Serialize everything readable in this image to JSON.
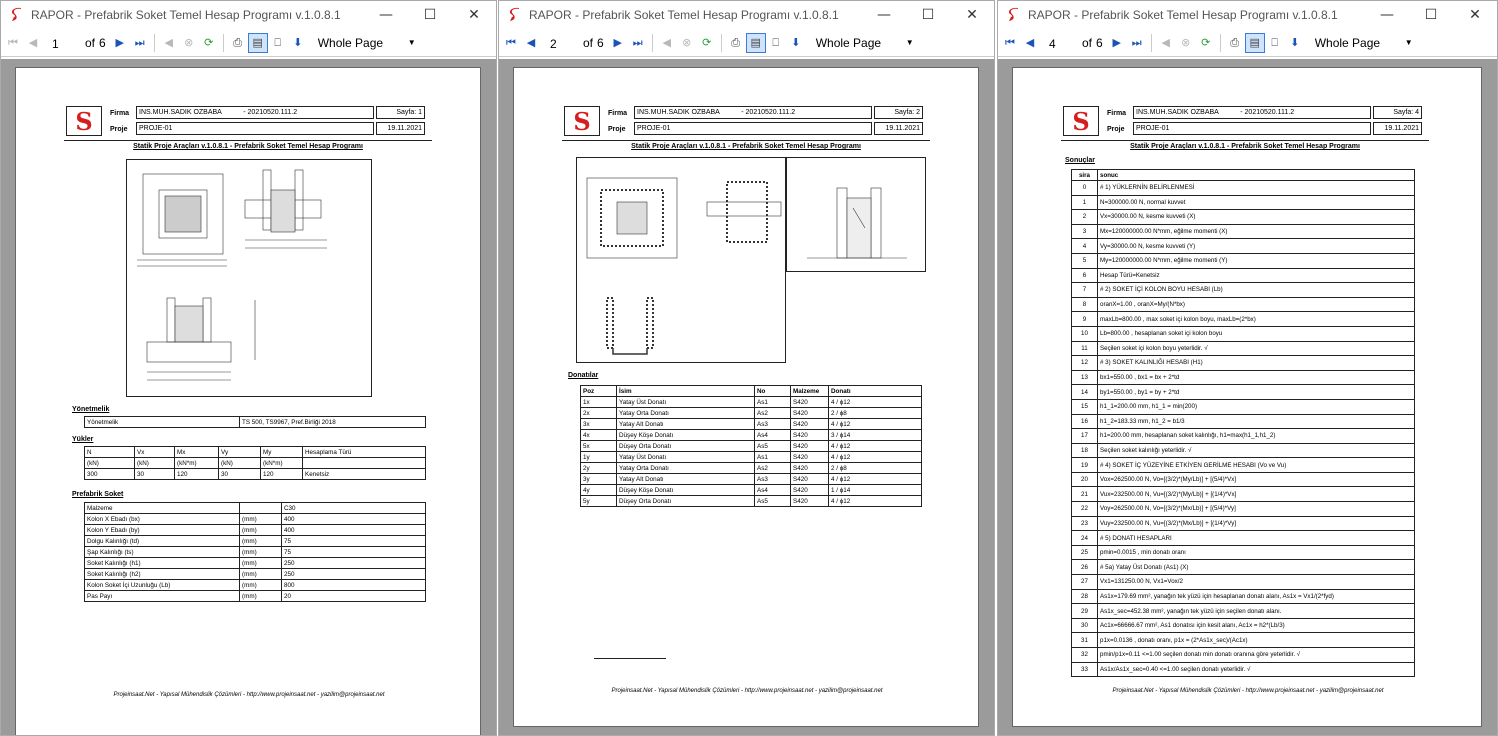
{
  "app": {
    "title": "RAPOR - Prefabrik Soket Temel Hesap Programı v.1.0.8.1",
    "minimize": "—",
    "maximize": "☐",
    "close": "✕"
  },
  "toolbar": {
    "of_label": "of",
    "total_pages": "6",
    "zoom": "Whole Page"
  },
  "windows": [
    {
      "page_input": "1"
    },
    {
      "page_input": "2"
    },
    {
      "page_input": "4"
    }
  ],
  "doc": {
    "firma_label": "Firma",
    "proje_label": "Proje",
    "firma_value": "INS.MUH.SADIK OZBABA",
    "code": "- 20210520.111.2",
    "proje_value": "PROJE-01",
    "date": "19.11.2021",
    "title": "Statik Proje Araçları v.1.0.8.1 - Prefabrik Soket Temel Hesap Programı",
    "footer": "Projeinsaat.Net - Yapısal Mühendislik Çözümleri - http://www.projeinsaat.net - yazilim@projeinsaat.net"
  },
  "page1": {
    "sayfa": "Sayfa: 1",
    "yonetmelik_title": "Yönetmelik",
    "yonetmelik_label": "Yönetmelik",
    "yonetmelik_value": "TS 500, TS9967, Pref.Birliği 2018",
    "yukler_title": "Yükler",
    "yukler_headers": [
      "N",
      "Vx",
      "Mx",
      "Vy",
      "My",
      "Hesaplama Türü"
    ],
    "yukler_units": [
      "(kN)",
      "(kN)",
      "(kN*m)",
      "(kN)",
      "(kN*m)",
      ""
    ],
    "yukler_values": [
      "300",
      "30",
      "120",
      "30",
      "120",
      "Kenetsiz"
    ],
    "soket_title": "Prefabrik Soket",
    "soket_rows": [
      [
        "Malzeme",
        "",
        "C30"
      ],
      [
        "Kolon X Ebadı (bx)",
        "(mm)",
        "400"
      ],
      [
        "Kolon Y Ebadı (by)",
        "(mm)",
        "400"
      ],
      [
        "Dolgu Kalınlığı (td)",
        "(mm)",
        "75"
      ],
      [
        "Şap Kalınlığı (ts)",
        "(mm)",
        "75"
      ],
      [
        "Soket Kalınlığı (h1)",
        "(mm)",
        "250"
      ],
      [
        "Soket Kalınlığı (h2)",
        "(mm)",
        "250"
      ],
      [
        "Kolon Soket İçi Uzunluğu (Lb)",
        "(mm)",
        "800"
      ],
      [
        "Pas Payı",
        "(mm)",
        "20"
      ]
    ]
  },
  "page2": {
    "sayfa": "Sayfa: 2",
    "donatilar_title": "Donatılar",
    "headers": [
      "Poz",
      "İsim",
      "No",
      "Malzeme",
      "Donatı"
    ],
    "rows": [
      [
        "1x",
        "Yatay Üst Donatı",
        "As1",
        "S420",
        "4 / ϕ12"
      ],
      [
        "2x",
        "Yatay Orta Donatı",
        "As2",
        "S420",
        "2 / ϕ8"
      ],
      [
        "3x",
        "Yatay Alt Donatı",
        "As3",
        "S420",
        "4 / ϕ12"
      ],
      [
        "4x",
        "Düşey Köşe Donatı",
        "As4",
        "S420",
        "3 / ϕ14"
      ],
      [
        "5x",
        "Düşey Orta Donatı",
        "As5",
        "S420",
        "4 / ϕ12"
      ],
      [
        "1y",
        "Yatay Üst Donatı",
        "As1",
        "S420",
        "4 / ϕ12"
      ],
      [
        "2y",
        "Yatay Orta Donatı",
        "As2",
        "S420",
        "2 / ϕ8"
      ],
      [
        "3y",
        "Yatay Alt Donatı",
        "As3",
        "S420",
        "4 / ϕ12"
      ],
      [
        "4y",
        "Düşey Köşe Donatı",
        "As4",
        "S420",
        "1 / ϕ14"
      ],
      [
        "5y",
        "Düşey Orta Donatı",
        "As5",
        "S420",
        "4 / ϕ12"
      ]
    ]
  },
  "page4": {
    "sayfa": "Sayfa: 4",
    "sonuclar_title": "Sonuçlar",
    "headers": [
      "sira",
      "sonuc"
    ],
    "rows": [
      [
        "0",
        "# 1) YÜKLERNİN BELİRLENMESİ"
      ],
      [
        "1",
        "N=300000.00 N, normal kuvvet"
      ],
      [
        "2",
        "Vx=30000.00 N, kesme kuvveti (X)"
      ],
      [
        "3",
        "Mx=120000000.00 N*mm, eğilme momenti (X)"
      ],
      [
        "4",
        "Vy=30000.00 N, kesme kuvveti (Y)"
      ],
      [
        "5",
        "My=120000000.00 N*mm, eğilme momenti (Y)"
      ],
      [
        "6",
        "Hesap Türü=Kenetsiz"
      ],
      [
        "7",
        "# 2) SOKET İÇİ KOLON BOYU HESABI (Lb)"
      ],
      [
        "8",
        "oranX=1.00 , oranX=My/(N*bx)"
      ],
      [
        "9",
        "maxLb=800.00 , max soket içi kolon boyu, maxLb=(2*bx)"
      ],
      [
        "10",
        "Lb=800.00 , hesaplanan soket içi kolon boyu"
      ],
      [
        "11",
        "Seçilen soket içi kolon boyu yeterlidir. √"
      ],
      [
        "12",
        "# 3) SOKET KALINLIĞI HESABI (H1)"
      ],
      [
        "13",
        "bx1=550.00 , bx1 = bx + 2*td"
      ],
      [
        "14",
        "by1=550.00 , by1 = by + 2*td"
      ],
      [
        "15",
        "h1_1=200.00 mm, h1_1 = min(200)"
      ],
      [
        "16",
        "h1_2=183.33 mm, h1_2 = b1/3"
      ],
      [
        "17",
        "h1=200.00 mm, hesaplanan soket kalınlığı, h1=max(h1_1,h1_2)"
      ],
      [
        "18",
        "Seçilen soket kalınlığı yeterlidir. √"
      ],
      [
        "19",
        "# 4) SOKET İÇ YÜZEYİNE ETKİYEN GERİLME HESABI (Vo ve Vu)"
      ],
      [
        "20",
        "Vox=262500.00 N,  Vo=[(3/2)*(My/Lb)] + [(5/4)*Vx]"
      ],
      [
        "21",
        "Vux=232500.00 N,  Vu=[(3/2)*(My/Lb)] + [(1/4)*Vx]"
      ],
      [
        "22",
        "Voy=262500.00 N,  Vo=[(3/2)*(Mx/Lb)] + [(5/4)*Vy]"
      ],
      [
        "23",
        "Vuy=232500.00 N,  Vu=[(3/2)*(Mx/Lb)] + [(1/4)*Vy]"
      ],
      [
        "24",
        "# 5) DONATI HESAPLARI"
      ],
      [
        "25",
        "pmin=0.0015 , min donatı oranı"
      ],
      [
        "26",
        "# 5a) Yatay Üst Donatı (As1) (X)"
      ],
      [
        "27",
        "Vx1=131250.00 N,  Vx1=Vox/2"
      ],
      [
        "28",
        "As1x=179.69 mm², yanağın tek yüzü için hesaplanan donatı alanı, As1x = Vx1/(2*fyd)"
      ],
      [
        "29",
        "As1x_sec=452.38 mm², yanağın tek yüzü için seçilen donatı alanı."
      ],
      [
        "30",
        "Ac1x=66666.67 mm², As1 donatısı için kesit alanı, Ac1x = h2*(Lb/3)"
      ],
      [
        "31",
        "p1x=0.0136 , donatı oranı, p1x = (2*As1x_sec)/(Ac1x)"
      ],
      [
        "32",
        "pmin/p1x=0.11 <=1.00 seçilen donatı min donatı oranına göre yeterlidir. √"
      ],
      [
        "33",
        "As1x/As1x_sec=0.40 <=1.00 seçilen donatı yeterlidir. √"
      ]
    ]
  }
}
